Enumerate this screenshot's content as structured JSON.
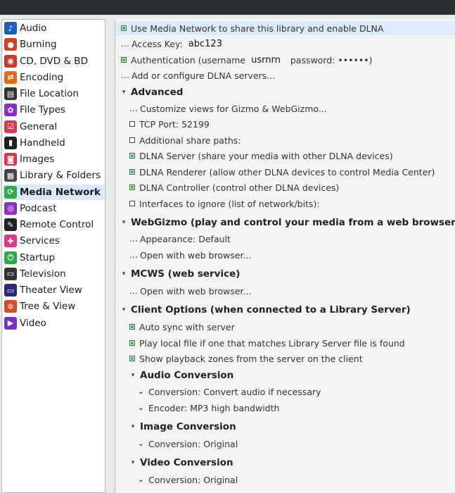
{
  "sidebar": {
    "items": [
      {
        "label": "Audio",
        "icon": "audio-icon",
        "color": "#1f5fbf",
        "glyph": "♪"
      },
      {
        "label": "Burning",
        "icon": "burning-icon",
        "color": "#d2401f",
        "glyph": "●"
      },
      {
        "label": "CD, DVD & BD",
        "icon": "disc-icon",
        "color": "#c43a2b",
        "glyph": "◉"
      },
      {
        "label": "Encoding",
        "icon": "encoding-icon",
        "color": "#e06a1a",
        "glyph": "⇄"
      },
      {
        "label": "File Location",
        "icon": "file-location-icon",
        "color": "#333333",
        "glyph": "▤"
      },
      {
        "label": "File Types",
        "icon": "file-types-icon",
        "color": "#8a2fc9",
        "glyph": "✿"
      },
      {
        "label": "General",
        "icon": "general-icon",
        "color": "#d63a4f",
        "glyph": "☑"
      },
      {
        "label": "Handheld",
        "icon": "handheld-icon",
        "color": "#222222",
        "glyph": "▮"
      },
      {
        "label": "Images",
        "icon": "images-icon",
        "color": "#d8344c",
        "glyph": "◙"
      },
      {
        "label": "Library & Folders",
        "icon": "library-icon",
        "color": "#444444",
        "glyph": "▦"
      },
      {
        "label": "Media Network",
        "icon": "media-network-icon",
        "color": "#2fa84a",
        "glyph": "⟳",
        "selected": true
      },
      {
        "label": "Podcast",
        "icon": "podcast-icon",
        "color": "#8c2fc7",
        "glyph": "◎"
      },
      {
        "label": "Remote Control",
        "icon": "remote-control-icon",
        "color": "#222222",
        "glyph": "✎"
      },
      {
        "label": "Services",
        "icon": "services-icon",
        "color": "#d63a8a",
        "glyph": "✚"
      },
      {
        "label": "Startup",
        "icon": "startup-icon",
        "color": "#2fa84a",
        "glyph": "⏻"
      },
      {
        "label": "Television",
        "icon": "television-icon",
        "color": "#333333",
        "glyph": "▭"
      },
      {
        "label": "Theater View",
        "icon": "theater-view-icon",
        "color": "#2a2a7a",
        "glyph": "▭"
      },
      {
        "label": "Tree & View",
        "icon": "tree-view-icon",
        "color": "#d84a2a",
        "glyph": "✲"
      },
      {
        "label": "Video",
        "icon": "video-icon",
        "color": "#7a2fc7",
        "glyph": "▶"
      }
    ]
  },
  "content": {
    "rows": [
      {
        "kind": "checkbox",
        "checked": true,
        "label": "Use Media Network to share this library and enable DLNA",
        "highlight": true
      },
      {
        "kind": "field",
        "label": "Access Key:",
        "value": "abc123"
      },
      {
        "kind": "auth",
        "checked": true,
        "label": "Authentication (username",
        "username": "usrnrn",
        "pw_label": "password:",
        "pw": "••••••)"
      },
      {
        "kind": "link",
        "label": "Add or configure DLNA servers..."
      },
      {
        "kind": "section",
        "label": "Advanced"
      },
      {
        "kind": "link",
        "label": "Customize views for Gizmo & WebGizmo..."
      },
      {
        "kind": "option",
        "label": "TCP Port: 52199"
      },
      {
        "kind": "option",
        "label": "Additional share paths:"
      },
      {
        "kind": "checkbox",
        "checked": true,
        "label": "DLNA Server (share your media with other DLNA devices)"
      },
      {
        "kind": "checkbox",
        "checked": true,
        "label": "DLNA Renderer (allow other DLNA devices to control Media Center)"
      },
      {
        "kind": "checkbox",
        "checked": true,
        "label": "DLNA Controller (control other DLNA devices)"
      },
      {
        "kind": "option",
        "label": "Interfaces to ignore (list of network/bits):"
      },
      {
        "kind": "section",
        "label": "WebGizmo (play and control your media from a web browser)"
      },
      {
        "kind": "link",
        "label": "Appearance: Default"
      },
      {
        "kind": "link",
        "label": "Open with web browser..."
      },
      {
        "kind": "section",
        "label": "MCWS (web service)"
      },
      {
        "kind": "link",
        "label": "Open with web browser..."
      },
      {
        "kind": "section",
        "label": "Client Options (when connected to a Library Server)"
      },
      {
        "kind": "checkbox",
        "checked": true,
        "label": "Auto sync with server"
      },
      {
        "kind": "checkbox",
        "checked": true,
        "label": "Play local file if one that matches Library Server file is found"
      },
      {
        "kind": "checkbox",
        "checked": true,
        "label": "Show playback zones from the server on the client"
      },
      {
        "kind": "section",
        "label": "Audio Conversion"
      },
      {
        "kind": "dropdown",
        "label": "Conversion: Convert audio if necessary"
      },
      {
        "kind": "dropdown",
        "label": "Encoder: MP3 high bandwidth"
      },
      {
        "kind": "section",
        "label": "Image Conversion"
      },
      {
        "kind": "dropdown",
        "label": "Conversion: Original"
      },
      {
        "kind": "section",
        "label": "Video Conversion"
      },
      {
        "kind": "dropdown",
        "label": "Conversion: Original"
      }
    ]
  }
}
